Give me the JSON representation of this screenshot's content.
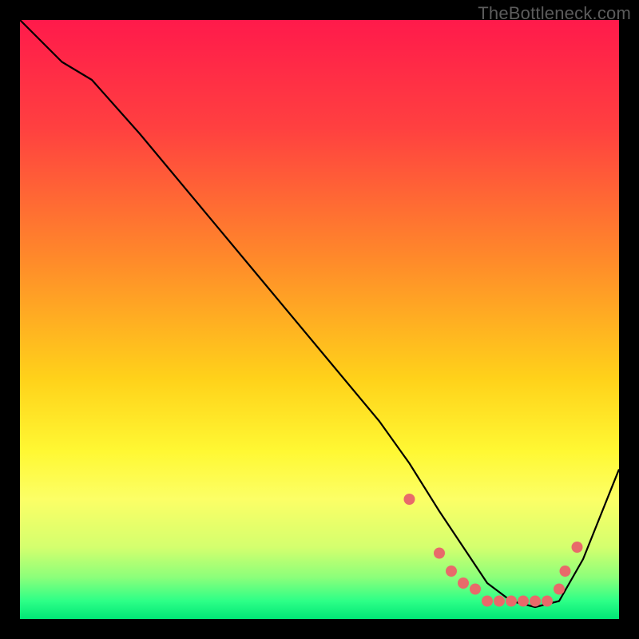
{
  "watermark": "TheBottleneck.com",
  "chart_data": {
    "type": "line",
    "title": "",
    "xlabel": "",
    "ylabel": "",
    "xlim": [
      0,
      100
    ],
    "ylim": [
      0,
      100
    ],
    "gradient_stops": [
      {
        "offset": 0,
        "color": "#ff1a4b"
      },
      {
        "offset": 18,
        "color": "#ff4040"
      },
      {
        "offset": 40,
        "color": "#ff8a2a"
      },
      {
        "offset": 60,
        "color": "#ffd21a"
      },
      {
        "offset": 72,
        "color": "#fff833"
      },
      {
        "offset": 80,
        "color": "#fcff66"
      },
      {
        "offset": 88,
        "color": "#d4ff6e"
      },
      {
        "offset": 93,
        "color": "#8cff7a"
      },
      {
        "offset": 97,
        "color": "#2dff87"
      },
      {
        "offset": 100,
        "color": "#00e676"
      }
    ],
    "series": [
      {
        "name": "curve",
        "x": [
          0,
          7,
          12,
          20,
          30,
          40,
          50,
          60,
          65,
          70,
          74,
          78,
          82,
          86,
          90,
          94,
          100
        ],
        "y": [
          100,
          93,
          90,
          81,
          69,
          57,
          45,
          33,
          26,
          18,
          12,
          6,
          3,
          2,
          3,
          10,
          25
        ]
      }
    ],
    "markers": {
      "name": "dots",
      "color": "#e86a6a",
      "radius": 7,
      "x": [
        65,
        70,
        72,
        74,
        76,
        78,
        80,
        82,
        84,
        86,
        88,
        90,
        91,
        93
      ],
      "y": [
        20,
        11,
        8,
        6,
        5,
        3,
        3,
        3,
        3,
        3,
        3,
        5,
        8,
        12
      ]
    }
  }
}
